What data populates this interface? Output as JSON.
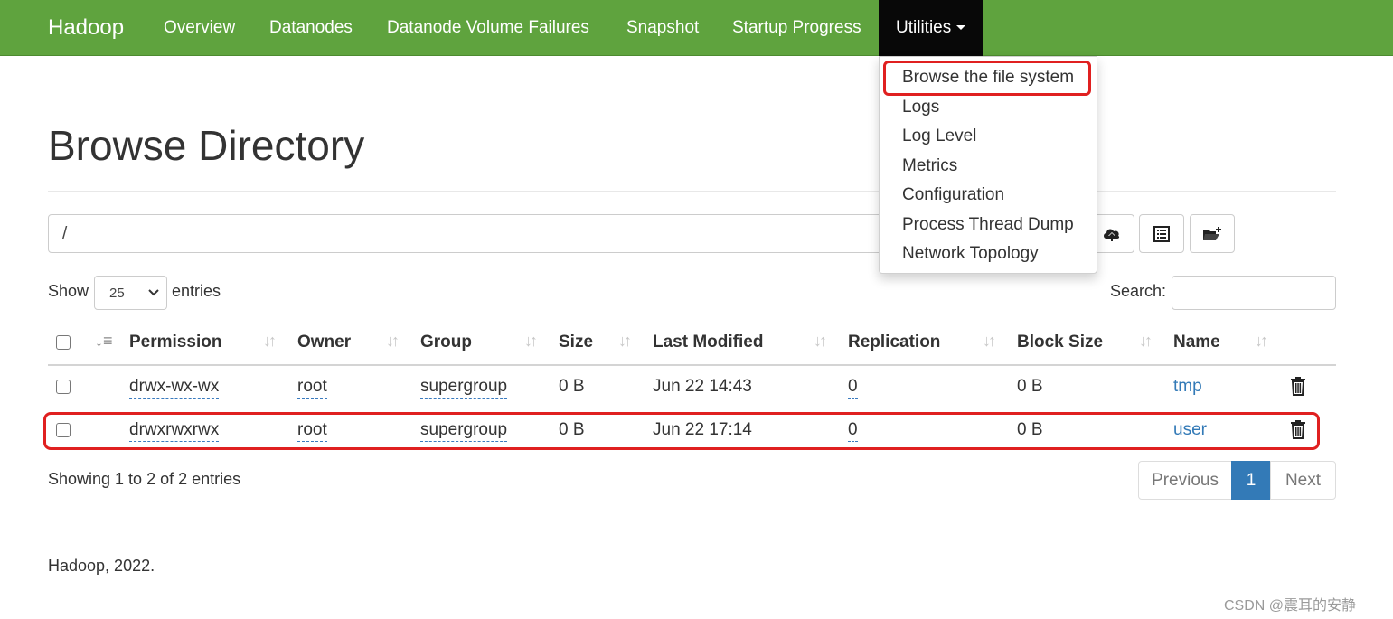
{
  "navbar": {
    "brand": "Hadoop",
    "items": [
      "Overview",
      "Datanodes",
      "Datanode Volume Failures",
      "Snapshot",
      "Startup Progress"
    ],
    "active_item": "Utilities"
  },
  "utilities_menu": {
    "items": [
      "Browse the file system",
      "Logs",
      "Log Level",
      "Metrics",
      "Configuration",
      "Process Thread Dump",
      "Network Topology"
    ]
  },
  "page": {
    "title": "Browse Directory"
  },
  "path_bar": {
    "value": "/"
  },
  "toolbar": {
    "icons": [
      "cloud-upload-icon",
      "list-icon",
      "new-folder-icon"
    ]
  },
  "length_control": {
    "show_label": "Show",
    "selected": "25",
    "entries_label": "entries"
  },
  "search": {
    "label": "Search:",
    "value": ""
  },
  "table": {
    "columns": [
      "Permission",
      "Owner",
      "Group",
      "Size",
      "Last Modified",
      "Replication",
      "Block Size",
      "Name"
    ],
    "rows": [
      {
        "permission": "drwx-wx-wx",
        "owner": "root",
        "group": "supergroup",
        "size": "0 B",
        "last_modified": "Jun 22 14:43",
        "replication": "0",
        "block_size": "0 B",
        "name": "tmp"
      },
      {
        "permission": "drwxrwxrwx",
        "owner": "root",
        "group": "supergroup",
        "size": "0 B",
        "last_modified": "Jun 22 17:14",
        "replication": "0",
        "block_size": "0 B",
        "name": "user"
      }
    ]
  },
  "table_info": "Showing 1 to 2 of 2 entries",
  "pagination": {
    "previous": "Previous",
    "current": "1",
    "next": "Next"
  },
  "footer": "Hadoop, 2022.",
  "watermark": "CSDN @震耳的安静",
  "colors": {
    "navbar": "#5fa33e",
    "active_nav": "#080808",
    "link": "#337ab7",
    "highlight": "#e02020"
  }
}
